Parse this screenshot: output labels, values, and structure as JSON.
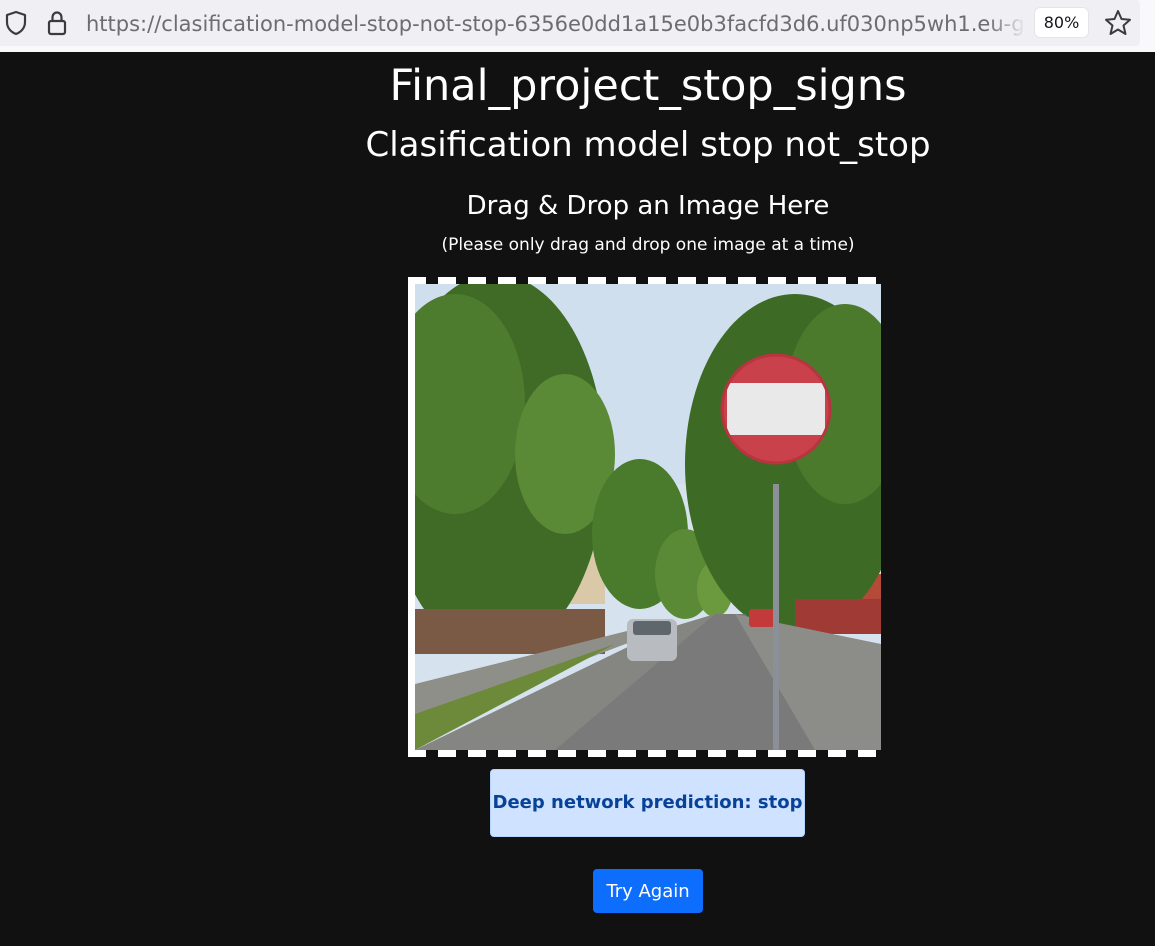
{
  "browser": {
    "url": "https://clasification-model-stop-not-stop-6356e0dd1a15e0b3facfd3d6.uf030np5wh1.eu-gb.codeengine",
    "zoom": "80%",
    "icons": [
      "shield-icon",
      "lock-icon",
      "star-icon"
    ]
  },
  "page": {
    "title": "Final_project_stop_signs",
    "subtitle": "Clasification model stop not_stop",
    "dropzone_heading": "Drag & Drop an Image Here",
    "dropzone_note": "(Please only drag and drop one image at a time)",
    "prediction_text": "Deep network prediction: stop",
    "try_again_label": "Try Again"
  },
  "colors": {
    "background": "#111111",
    "prediction_bg": "#cfe2ff",
    "prediction_text": "#084298",
    "button_bg": "#0d6efd"
  }
}
